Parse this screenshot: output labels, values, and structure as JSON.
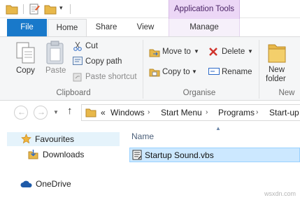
{
  "titlebar": {
    "contextual_group": "Application Tools"
  },
  "tabs": [
    {
      "label": "File"
    },
    {
      "label": "Home"
    },
    {
      "label": "Share"
    },
    {
      "label": "View"
    },
    {
      "label": "Manage"
    }
  ],
  "ribbon": {
    "clipboard": {
      "copy": "Copy",
      "paste": "Paste",
      "cut": "Cut",
      "copy_path": "Copy path",
      "paste_shortcut": "Paste shortcut",
      "group_label": "Clipboard"
    },
    "organise": {
      "move_to": "Move to",
      "copy_to": "Copy to",
      "delete": "Delete",
      "rename": "Rename",
      "group_label": "Organise"
    },
    "new": {
      "new_folder_line1": "New",
      "new_folder_line2": "folder",
      "group_label": "New"
    }
  },
  "address": {
    "overflow": "«",
    "crumbs": [
      "Windows",
      "Start Menu",
      "Programs",
      "Start-up"
    ]
  },
  "nav_pane": {
    "favourites": "Favourites",
    "downloads": "Downloads",
    "onedrive": "OneDrive"
  },
  "files": {
    "column_name": "Name",
    "items": [
      {
        "name": "Startup Sound.vbs",
        "icon": "vbs-script-icon"
      }
    ]
  },
  "watermark": "wsxdn.com",
  "colors": {
    "file_tab": "#1979ca",
    "contextual": "#ecd7f6",
    "selection": "#cce8ff"
  }
}
